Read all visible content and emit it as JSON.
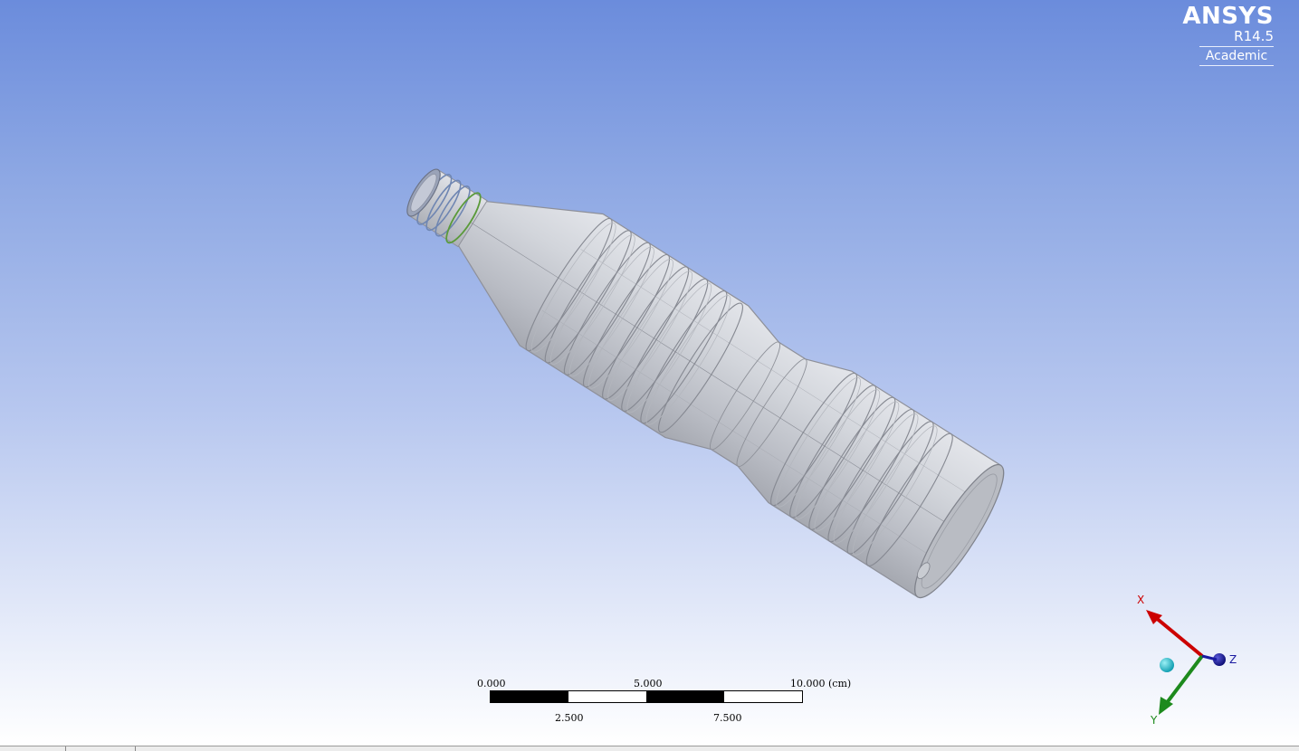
{
  "logo": {
    "brand": "ANSYS",
    "version": "R14.5",
    "edition": "Academic"
  },
  "scale_bar": {
    "top_labels": [
      "0.000",
      "5.000",
      "10.000 (cm)"
    ],
    "bottom_labels": [
      "2.500",
      "7.500"
    ]
  },
  "triad": {
    "x_label": "X",
    "y_label": "Y",
    "z_label": "Z"
  },
  "colors": {
    "background_top": "#6b8cdc",
    "background_bottom": "#ffffff",
    "model_fill": "#c9ccd3",
    "axis_x": "#cc0000",
    "axis_y": "#1d8a1d",
    "axis_z": "#1a1aa0",
    "isometric_ball": "#18b8c8"
  },
  "icons": [
    "bottle-model",
    "axis-triad-icon",
    "scale-bar"
  ]
}
